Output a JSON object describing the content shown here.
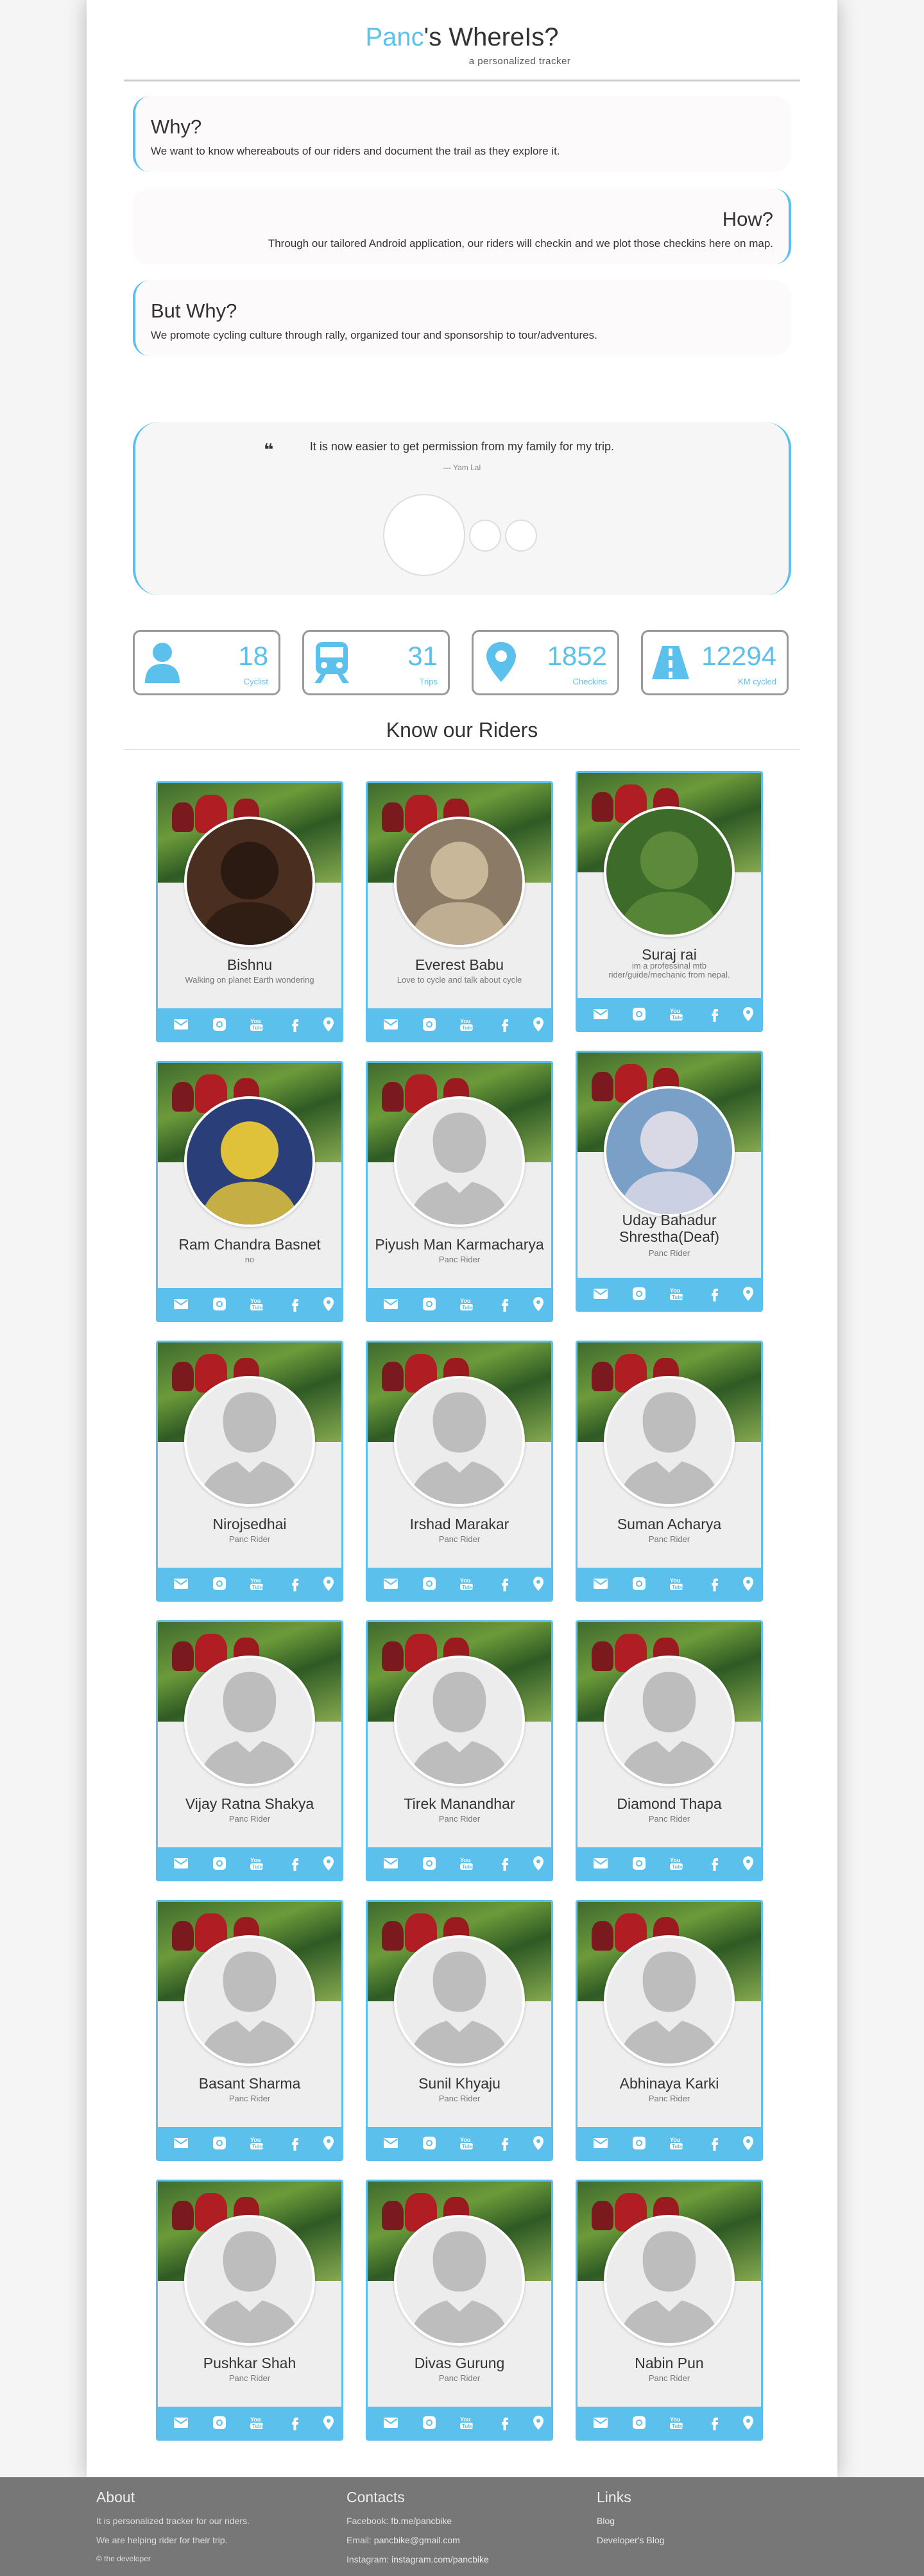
{
  "brand": {
    "panc": "Panc",
    "rest": "'s WhereIs?",
    "tagline": "a personalized tracker"
  },
  "why": {
    "title": "Why?",
    "text": "We want to know whereabouts of our riders and document the trail as they explore it."
  },
  "how": {
    "title": "How?",
    "text": "Through our tailored Android application, our riders will checkin and we plot those checkins here on map."
  },
  "butwhy": {
    "title": "But Why?",
    "text": "We promote cycling culture through rally, organized tour and sponsorship to tour/adventures."
  },
  "testimonial": {
    "quote_mark": "❝",
    "text": "It is now easier to get permission from my family for my trip.",
    "author": "— Yam Lal"
  },
  "stats": [
    {
      "icon": "user-icon",
      "value": "18",
      "label": "Cyclist"
    },
    {
      "icon": "train-icon",
      "value": "31",
      "label": "Trips"
    },
    {
      "icon": "map-marker-icon",
      "value": "1852",
      "label": "Checkins"
    },
    {
      "icon": "road-icon",
      "value": "12294",
      "label": "KM cycled"
    }
  ],
  "riders_title": "Know our Riders",
  "riders": [
    {
      "name": "Bishnu",
      "desc": "Walking on planet Earth wondering",
      "photo": "photo-dark"
    },
    {
      "name": "Everest Babu",
      "desc": "Love to cycle and talk about cycle",
      "photo": "photo-scarf"
    },
    {
      "name": "Suraj rai",
      "desc": "im a professinal mtb rider/guide/mechanic from nepal.",
      "photo": "photo-forest"
    },
    {
      "name": "Ram Chandra Basnet",
      "desc": "no",
      "photo": "photo-helmet"
    },
    {
      "name": "Piyush Man Karmacharya",
      "desc": "Panc Rider",
      "photo": "placeholder"
    },
    {
      "name": "Uday Bahadur Shrestha(Deaf)",
      "desc": "Panc Rider",
      "photo": "photo-helmet-white"
    },
    {
      "name": "Nirojsedhai",
      "desc": "Panc Rider",
      "photo": "placeholder"
    },
    {
      "name": "Irshad Marakar",
      "desc": "Panc Rider",
      "photo": "placeholder"
    },
    {
      "name": "Suman Acharya",
      "desc": "Panc Rider",
      "photo": "placeholder"
    },
    {
      "name": "Vijay Ratna Shakya",
      "desc": "Panc Rider",
      "photo": "placeholder"
    },
    {
      "name": "Tirek Manandhar",
      "desc": "Panc Rider",
      "photo": "placeholder"
    },
    {
      "name": "Diamond Thapa",
      "desc": "Panc Rider",
      "photo": "placeholder"
    },
    {
      "name": "Basant Sharma",
      "desc": "Panc Rider",
      "photo": "placeholder"
    },
    {
      "name": "Sunil Khyaju",
      "desc": "Panc Rider",
      "photo": "placeholder"
    },
    {
      "name": "Abhinaya Karki",
      "desc": "Panc Rider",
      "photo": "placeholder"
    },
    {
      "name": "Pushkar Shah",
      "desc": "Panc Rider",
      "photo": "placeholder"
    },
    {
      "name": "Divas Gurung",
      "desc": "Panc Rider",
      "photo": "placeholder"
    },
    {
      "name": "Nabin Pun",
      "desc": "Panc Rider",
      "photo": "placeholder"
    }
  ],
  "card_icons": [
    "envelope-icon",
    "instagram-icon",
    "youtube-icon",
    "facebook-icon",
    "map-marker-icon"
  ],
  "footer": {
    "about": {
      "title": "About",
      "line1": "It is personalized tracker for our riders.",
      "line2": "We are helping rider for their trip.",
      "line3": "© the developer"
    },
    "contacts": {
      "title": "Contacts",
      "fb_label": "Facebook:",
      "fb_value": "fb.me/pancbike",
      "email_label": "Email:",
      "email_value": "pancbike@gmail.com",
      "ig_label": "Instagram:",
      "ig_value": "instagram.com/pancbike"
    },
    "links": {
      "title": "Links",
      "blog": "Blog",
      "dev_blog": "Developer's Blog"
    }
  },
  "colors": {
    "accent": "#5bc0eb",
    "footer_bg": "#777777"
  }
}
